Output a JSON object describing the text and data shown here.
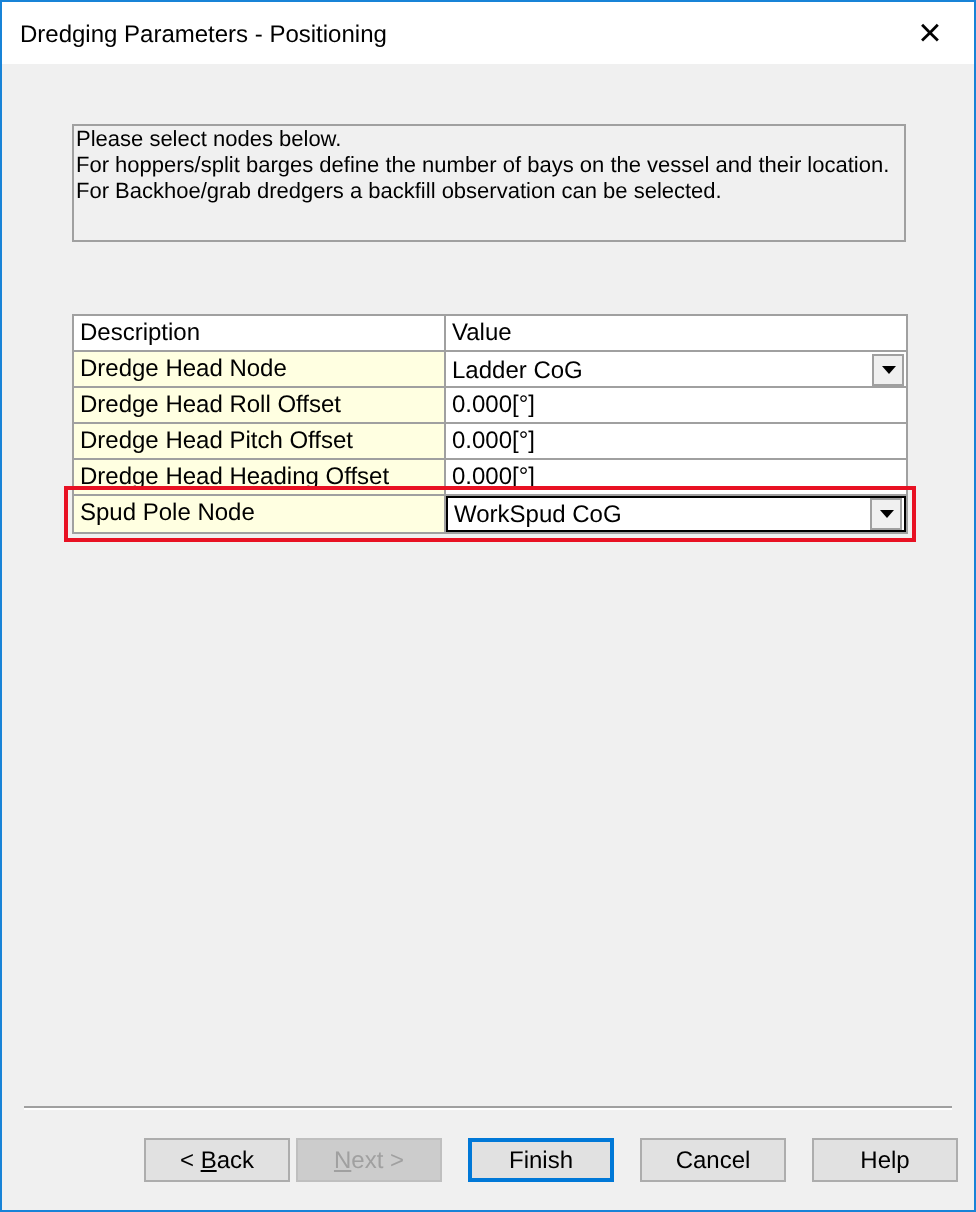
{
  "window": {
    "title": "Dredging Parameters - Positioning",
    "close": "×"
  },
  "info_lines": [
    "Please select nodes below.",
    "For hoppers/split barges define the number of bays on the vessel and their location.",
    "For Backhoe/grab dredgers a backfill observation can be selected."
  ],
  "table": {
    "columns": [
      "Description",
      "Value"
    ],
    "rows": [
      {
        "description": "Dredge Head Node",
        "value": "Ladder CoG",
        "kind": "dropdown",
        "highlighted": false
      },
      {
        "description": "Dredge Head Roll Offset",
        "value": "0.000[°]",
        "kind": "text",
        "highlighted": false
      },
      {
        "description": "Dredge Head Pitch Offset",
        "value": "0.000[°]",
        "kind": "text",
        "highlighted": false
      },
      {
        "description": "Dredge Head Heading Offset",
        "value": "0.000[°]",
        "kind": "text",
        "highlighted": false
      },
      {
        "description": "Spud Pole Node",
        "value": "WorkSpud CoG",
        "kind": "dropdown",
        "highlighted": true
      }
    ]
  },
  "buttons": [
    {
      "before": "< ",
      "mnemonic": "B",
      "after": "ack",
      "disabled": false,
      "default": false
    },
    {
      "mnemonic": "N",
      "after": "ext >",
      "disabled": true,
      "default": false
    },
    {
      "before": "Finish",
      "disabled": false,
      "default": true
    },
    {
      "before": "Cancel",
      "disabled": false,
      "default": false
    },
    {
      "before": "Help",
      "disabled": false,
      "default": false
    }
  ]
}
